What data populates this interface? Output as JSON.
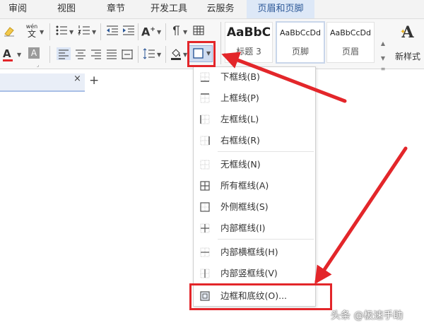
{
  "tabs": [
    {
      "label": "审阅"
    },
    {
      "label": "视图"
    },
    {
      "label": "章节"
    },
    {
      "label": "开发工具"
    },
    {
      "label": "云服务"
    },
    {
      "label": "页眉和页脚",
      "active": true
    }
  ],
  "ribbon": {
    "pinyin_glyph_top": "wén",
    "pinyin_glyph_bottom": "文",
    "font_color_glyph": "A",
    "char_shade_glyph": "A",
    "grow_font_glyph": "A",
    "grow_font_sup": "+",
    "styles": [
      {
        "sample": "AaBbC",
        "label": "标题 3"
      },
      {
        "sample": "AaBbCcDd",
        "label": "页脚",
        "selected": true
      },
      {
        "sample": "AaBbCcDd",
        "label": "页眉"
      }
    ],
    "new_style_label": "新样式",
    "new_style_glyph": "A",
    "accent_color": "#2b5797"
  },
  "doc_tab": {
    "close_glyph": "×",
    "add_glyph": "+"
  },
  "border_menu": {
    "items": [
      {
        "label": "下框线(B)",
        "icon": "bottom-border-icon"
      },
      {
        "label": "上框线(P)",
        "icon": "top-border-icon"
      },
      {
        "label": "左框线(L)",
        "icon": "left-border-icon"
      },
      {
        "label": "右框线(R)",
        "icon": "right-border-icon"
      },
      {
        "label": "无框线(N)",
        "icon": "no-border-icon"
      },
      {
        "label": "所有框线(A)",
        "icon": "all-borders-icon"
      },
      {
        "label": "外侧框线(S)",
        "icon": "outside-borders-icon"
      },
      {
        "label": "内部框线(I)",
        "icon": "inside-borders-icon"
      },
      {
        "label": "内部横框线(H)",
        "icon": "inside-horizontal-border-icon"
      },
      {
        "label": "内部竖框线(V)",
        "icon": "inside-vertical-border-icon"
      },
      {
        "label": "边框和底纹(O)...",
        "icon": "borders-and-shading-icon"
      }
    ]
  },
  "annotation_color": "#e3262a",
  "watermark": "头条 @极速手助"
}
